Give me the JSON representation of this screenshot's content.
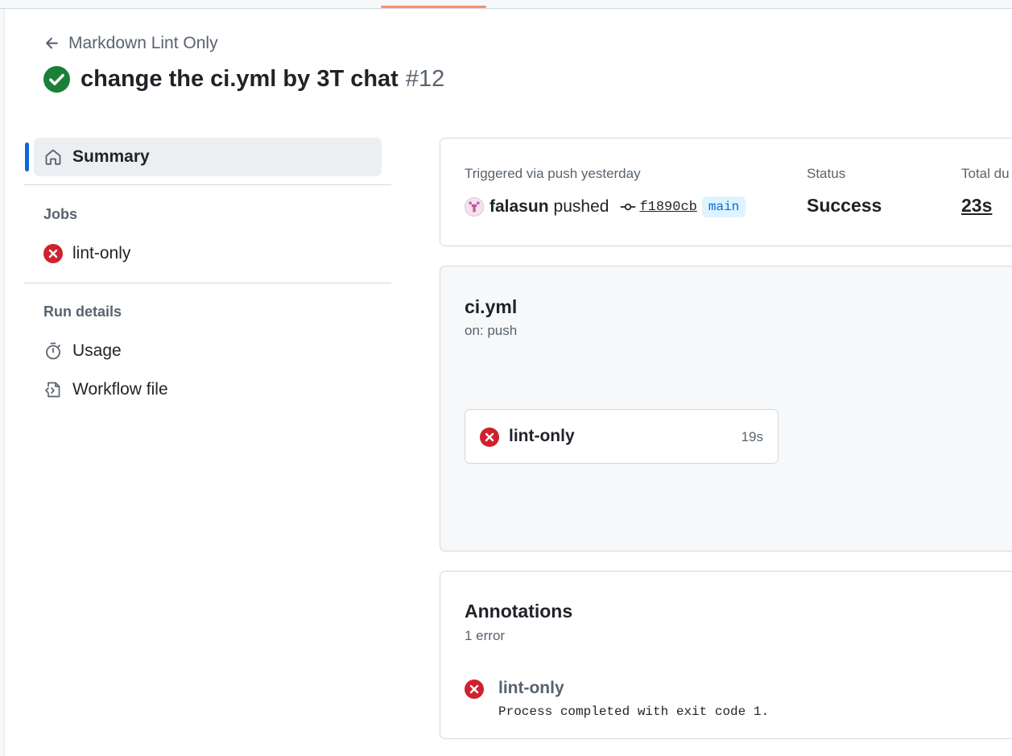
{
  "header": {
    "back_label": "Markdown Lint Only",
    "run_title": "change the ci.yml by 3T chat",
    "run_number": "#12"
  },
  "sidebar": {
    "summary_label": "Summary",
    "jobs_heading": "Jobs",
    "jobs": [
      {
        "label": "lint-only",
        "status": "failure"
      }
    ],
    "run_details_heading": "Run details",
    "run_details": [
      {
        "label": "Usage"
      },
      {
        "label": "Workflow file"
      }
    ]
  },
  "summary_card": {
    "trigger_text": "Triggered via push yesterday",
    "actor": "falasun",
    "action": "pushed",
    "commit_sha": "f1890cb",
    "branch": "main",
    "status_label": "Status",
    "status_value": "Success",
    "duration_label": "Total du",
    "duration_value": "23s"
  },
  "workflow_graph": {
    "file_name": "ci.yml",
    "trigger": "on: push",
    "job": {
      "name": "lint-only",
      "duration": "19s",
      "status": "failure"
    }
  },
  "annotations": {
    "title": "Annotations",
    "count_text": "1 error",
    "items": [
      {
        "job": "lint-only",
        "message": "Process completed with exit code 1."
      }
    ]
  },
  "colors": {
    "success": "#1a7f37",
    "failure": "#cf222e",
    "accent": "#0969da",
    "tab_underline": "#fd8c73"
  }
}
